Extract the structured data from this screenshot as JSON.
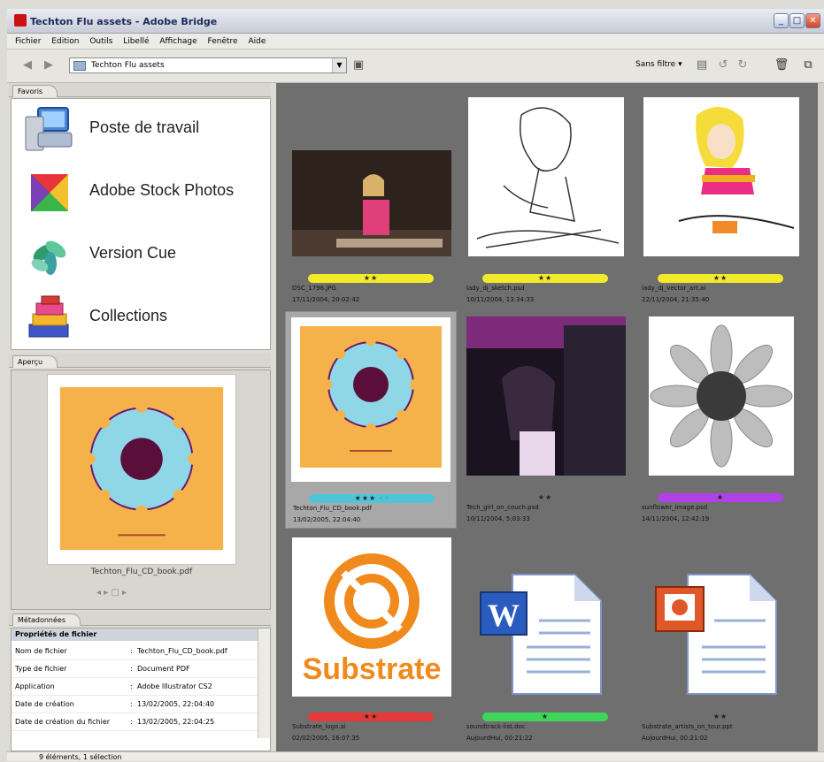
{
  "window": {
    "title": "Techton Flu assets - Adobe Bridge"
  },
  "menu": [
    "Fichier",
    "Edition",
    "Outils",
    "Libellé",
    "Affichage",
    "Fenêtre",
    "Aide"
  ],
  "toolbar": {
    "path": "Techton Flu assets",
    "filter": "Sans filtre ▾"
  },
  "panels": {
    "favorites_tab": "Favoris",
    "favorites": [
      "Poste de travail",
      "Adobe Stock Photos",
      "Version Cue",
      "Collections"
    ],
    "preview_tab": "Aperçu",
    "preview_name": "Techton_Flu_CD_book.pdf",
    "metadata_tab": "Métadonnées",
    "metadata_section": "Propriétés de fichier",
    "metadata_rows": [
      {
        "key": "Nom de fichier",
        "value": "Techton_Flu_CD_book.pdf"
      },
      {
        "key": "Type de fichier",
        "value": "Document PDF"
      },
      {
        "key": "Application",
        "value": "Adobe Illustrator CS2"
      },
      {
        "key": "Date de création",
        "value": "13/02/2005, 22:04:40"
      },
      {
        "key": "Date de création du fichier",
        "value": "13/02/2005, 22:04:25"
      }
    ]
  },
  "thumbnails": [
    {
      "name": "DSC_1796.JPG",
      "date": "17/11/2004, 20:02:42",
      "stars": "★★",
      "label_color": "#f2ea2a"
    },
    {
      "name": "lady_dj_sketch.psd",
      "date": "10/11/2004, 13:34:33",
      "stars": "★★",
      "label_color": "#f2ea2a"
    },
    {
      "name": "lady_dj_vector_art.ai",
      "date": "22/11/2004, 21:35:40",
      "stars": "★★",
      "label_color": "#f2ea2a"
    },
    {
      "name": "Techton_Flu_CD_book.pdf",
      "date": "13/02/2005, 22:04:40",
      "stars": "★★★ · ·",
      "label_color": "#4fc6d8"
    },
    {
      "name": "Tech_girl_on_couch.psd",
      "date": "10/11/2004, 5:03:33",
      "stars": "★★",
      "label_color": ""
    },
    {
      "name": "sunflower_image.psd",
      "date": "14/11/2004, 12:42:19",
      "stars": "★",
      "label_color": "#b040e8"
    },
    {
      "name": "Substrate_logo.ai",
      "date": "02/02/2005, 16:07:35",
      "stars": "★★",
      "label_color": "#e53a3a"
    },
    {
      "name": "soundtrack-list.doc",
      "date": "AujourdHui, 00:21:22",
      "stars": "★",
      "label_color": "#3ed65a"
    },
    {
      "name": "Substrate_artists_on_tour.ppt",
      "date": "AujourdHui, 00:21:02",
      "stars": "★★",
      "label_color": ""
    }
  ],
  "substrate_logo_text": "Substrate",
  "status": {
    "text": "9 éléments, 1 sélection"
  }
}
